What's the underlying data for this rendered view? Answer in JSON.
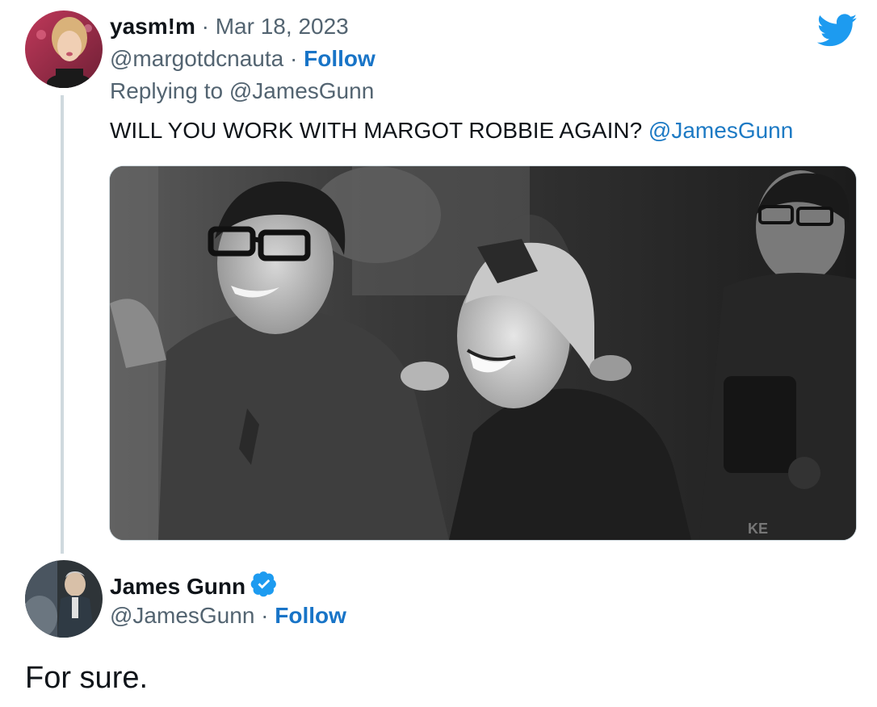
{
  "original_tweet": {
    "display_name": "yasm!m",
    "separator": "·",
    "date": "Mar 18, 2023",
    "handle": "@margotdcnauta",
    "follow_label": "Follow",
    "replying_to_prefix": "Replying to",
    "replying_to_handle": "@JamesGunn",
    "text": "WILL YOU WORK WITH MARGOT ROBBIE AGAIN?",
    "mention": "@JamesGunn",
    "media_icon": "photo",
    "avatar_icon": "user-avatar"
  },
  "reply_tweet": {
    "display_name": "James Gunn",
    "verified_icon": "verified-badge-icon",
    "handle": "@JamesGunn",
    "separator": "·",
    "follow_label": "Follow",
    "text": "For sure.",
    "avatar_icon": "user-avatar"
  },
  "brand": {
    "icon": "twitter-bird-icon",
    "color": "#1d9bf0"
  },
  "colors": {
    "link": "#1d7ac4",
    "muted": "#536471",
    "thread_line": "#cfd9de"
  }
}
